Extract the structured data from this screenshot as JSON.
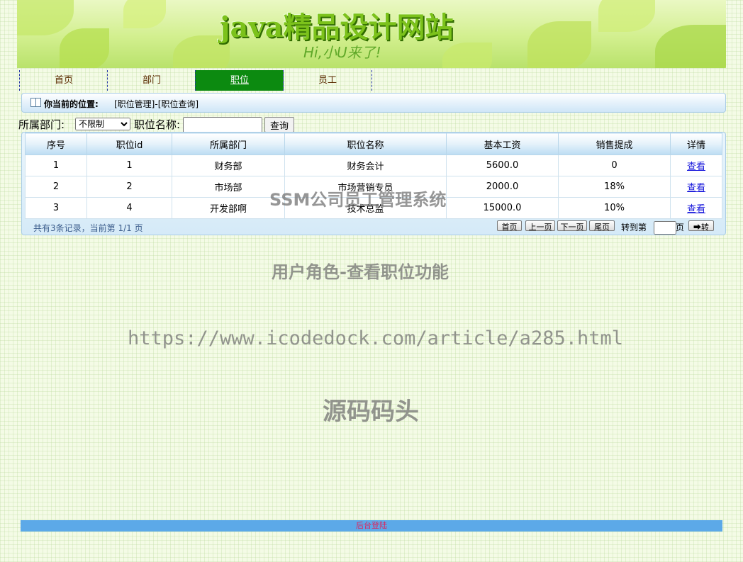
{
  "banner": {
    "title": "java精品设计网站",
    "subtitle": "Hi,小U来了!"
  },
  "nav": {
    "items": [
      {
        "label": "首页",
        "active": false
      },
      {
        "label": "部门",
        "active": false
      },
      {
        "label": "职位",
        "active": true
      },
      {
        "label": "员工",
        "active": false
      }
    ]
  },
  "location": {
    "label": "你当前的位置:",
    "path": "[职位管理]-[职位查询]"
  },
  "search": {
    "dept_label": "所属部门:",
    "dept_selected": "不限制",
    "name_label": "职位名称:",
    "name_value": "",
    "button": "查询"
  },
  "table": {
    "headers": [
      "序号",
      "职位id",
      "所属部门",
      "职位名称",
      "基本工资",
      "销售提成",
      "详情"
    ],
    "rows": [
      [
        "1",
        "1",
        "财务部",
        "财务会计",
        "5600.0",
        "0",
        "查看"
      ],
      [
        "2",
        "2",
        "市场部",
        "市场营销专员",
        "2000.0",
        "18%",
        "查看"
      ],
      [
        "3",
        "4",
        "开发部啊",
        "技术总监",
        "15000.0",
        "10%",
        "查看"
      ]
    ]
  },
  "pager": {
    "info": "共有3条记录，当前第 1/1 页",
    "first": "首页",
    "prev": "上一页",
    "next": "下一页",
    "last": "尾页",
    "goto_label": "转到第",
    "page_unit": "页",
    "go_button": "➡转"
  },
  "watermarks": {
    "w1": "SSM公司员工管理系统",
    "w2": "用户角色-查看职位功能",
    "w3": "https://www.icodedock.com/article/a285.html",
    "w4": "源码码头"
  },
  "footer": {
    "link": "后台登陆"
  }
}
